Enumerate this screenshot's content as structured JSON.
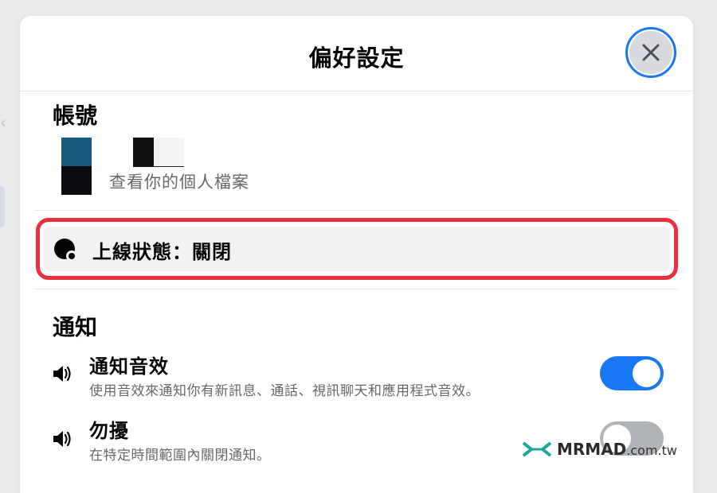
{
  "modal": {
    "title": "偏好設定",
    "close_icon": "close-icon"
  },
  "account": {
    "heading": "帳號",
    "profile_link": "查看你的個人檔案"
  },
  "status": {
    "icon": "active-status-icon",
    "label": "上線狀態：關閉",
    "highlight_color": "#e8313d"
  },
  "notifications": {
    "heading": "通知",
    "items": [
      {
        "icon": "speaker-icon",
        "label": "通知音效",
        "description": "使用音效來通知你有新訊息、通話、視訊聊天和應用程式音效。",
        "enabled": true
      },
      {
        "icon": "speaker-icon",
        "label": "勿擾",
        "description": "在特定時間範圍內關閉通知。",
        "enabled": false
      }
    ]
  },
  "colors": {
    "accent": "#1877f2",
    "toggle_off": "#b0b3b8",
    "secondary_text": "#65676b"
  },
  "watermark": {
    "brand": "MRMAD",
    "domain": ".com.tw"
  }
}
